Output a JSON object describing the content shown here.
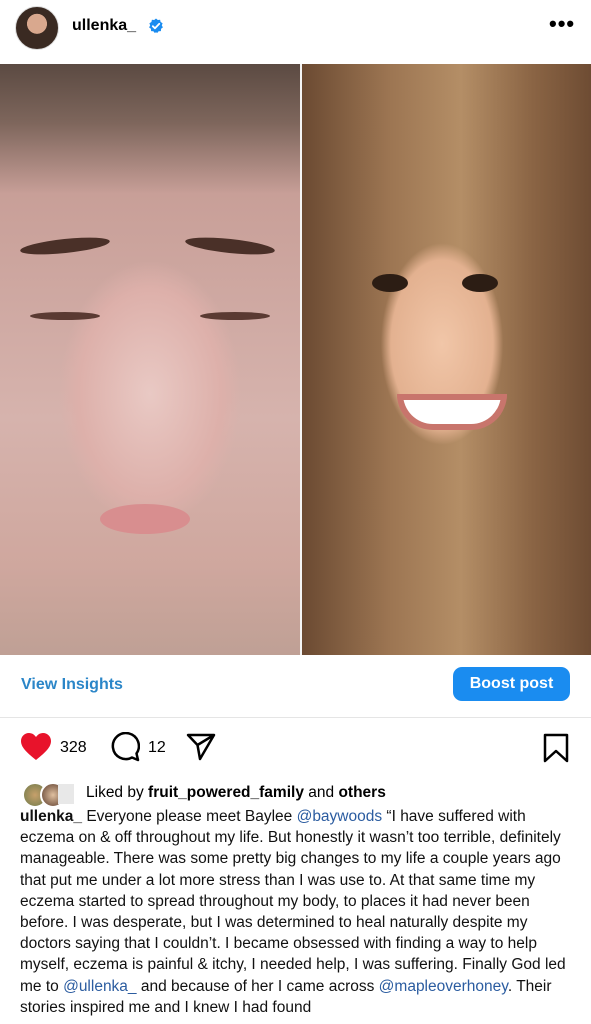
{
  "header": {
    "username": "ullenka_",
    "more_icon": "more-horizontal-icon"
  },
  "post": {
    "image_left_alt": "",
    "image_right_alt": ""
  },
  "insights": {
    "view_label": "View Insights",
    "boost_label": "Boost post"
  },
  "actions": {
    "likes": "328",
    "comments": "12"
  },
  "liked_by": {
    "prefix": "Liked by ",
    "user": "fruit_powered_family",
    "middle": " and ",
    "others": "others"
  },
  "caption": {
    "username": "ullenka_",
    "part1": " Everyone please meet Baylee ",
    "mention1": "@baywoods",
    "part2": " “I have suffered with eczema on & off throughout my life. But honestly it wasn’t too terrible, definitely manageable. There was some pretty big changes to my life a couple years ago that put me under a lot more stress than I was use to. At that same time my eczema started to spread throughout my body, to places it had never been before. I was desperate, but I was determined to heal naturally despite my doctors saying that I couldn’t. I became obsessed with finding a way to help myself, eczema is painful & itchy, I needed help, I was suffering. Finally God led me to ",
    "mention2": "@ullenka_",
    "part3": " and because of her I came across ",
    "mention3": "@mapleoverhoney",
    "part4": ". Their stories inspired me and I knew I had found"
  },
  "colors": {
    "accent": "#1a8cf0",
    "link": "#2b86c8",
    "heart": "#e8132b",
    "verified": "#1a8cf0"
  }
}
